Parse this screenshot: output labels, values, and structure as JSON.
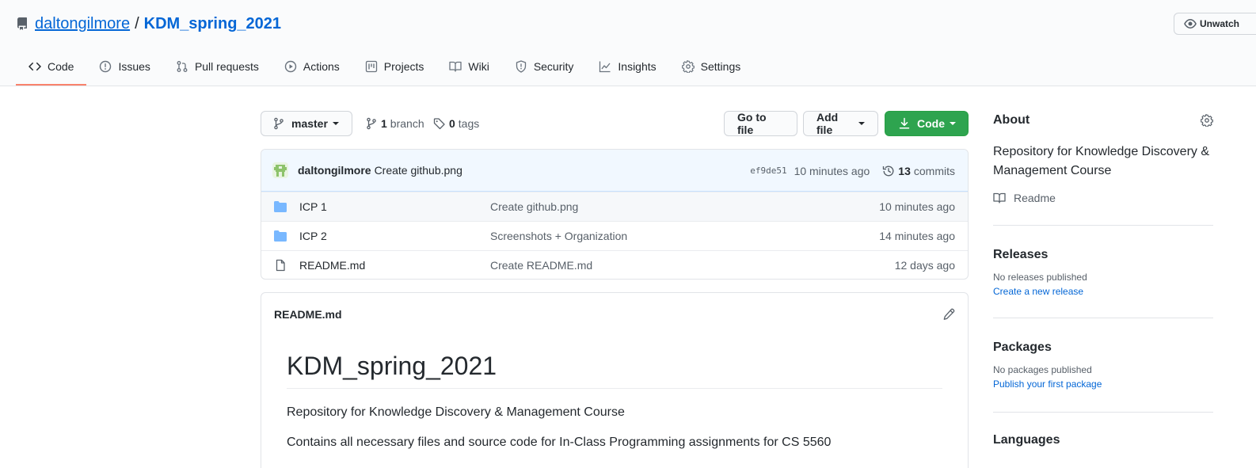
{
  "repo": {
    "owner": "daltongilmore",
    "separator": "/",
    "name": "KDM_spring_2021",
    "watch_label": "Unwatch"
  },
  "tabs": [
    {
      "label": "Code",
      "icon": "code-icon"
    },
    {
      "label": "Issues",
      "icon": "issue-icon"
    },
    {
      "label": "Pull requests",
      "icon": "pull-request-icon"
    },
    {
      "label": "Actions",
      "icon": "play-icon"
    },
    {
      "label": "Projects",
      "icon": "project-icon"
    },
    {
      "label": "Wiki",
      "icon": "book-icon"
    },
    {
      "label": "Security",
      "icon": "shield-icon"
    },
    {
      "label": "Insights",
      "icon": "graph-icon"
    },
    {
      "label": "Settings",
      "icon": "gear-icon"
    }
  ],
  "toolbar": {
    "branch": "master",
    "branch_count": "1",
    "branch_label": "branch",
    "tag_count": "0",
    "tag_label": "tags",
    "go_to_file": "Go to file",
    "add_file": "Add file",
    "code": "Code"
  },
  "latest_commit": {
    "author": "daltongilmore",
    "message": "Create github.png",
    "sha": "ef9de51",
    "age": "10 minutes ago",
    "commit_count": "13",
    "commit_label": "commits"
  },
  "files": [
    {
      "name": "ICP 1",
      "type": "folder",
      "message": "Create github.png",
      "age": "10 minutes ago"
    },
    {
      "name": "ICP 2",
      "type": "folder",
      "message": "Screenshots + Organization",
      "age": "14 minutes ago"
    },
    {
      "name": "README.md",
      "type": "file",
      "message": "Create README.md",
      "age": "12 days ago"
    }
  ],
  "readme": {
    "filename": "README.md",
    "title": "KDM_spring_2021",
    "paragraphs": [
      "Repository for Knowledge Discovery & Management Course",
      "Contains all necessary files and source code for In-Class Programming assignments for CS 5560"
    ]
  },
  "sidebar": {
    "about_title": "About",
    "description": "Repository for Knowledge Discovery & Management Course",
    "readme_link": "Readme",
    "releases_title": "Releases",
    "releases_none": "No releases published",
    "releases_link": "Create a new release",
    "packages_title": "Packages",
    "packages_none": "No packages published",
    "packages_link": "Publish your first package",
    "languages_title": "Languages"
  },
  "colors": {
    "accent_blue": "#0366d6",
    "selected_tab_underline": "#f9826c",
    "code_button_green": "#2ea44f",
    "folder_blue": "#79b8ff"
  }
}
